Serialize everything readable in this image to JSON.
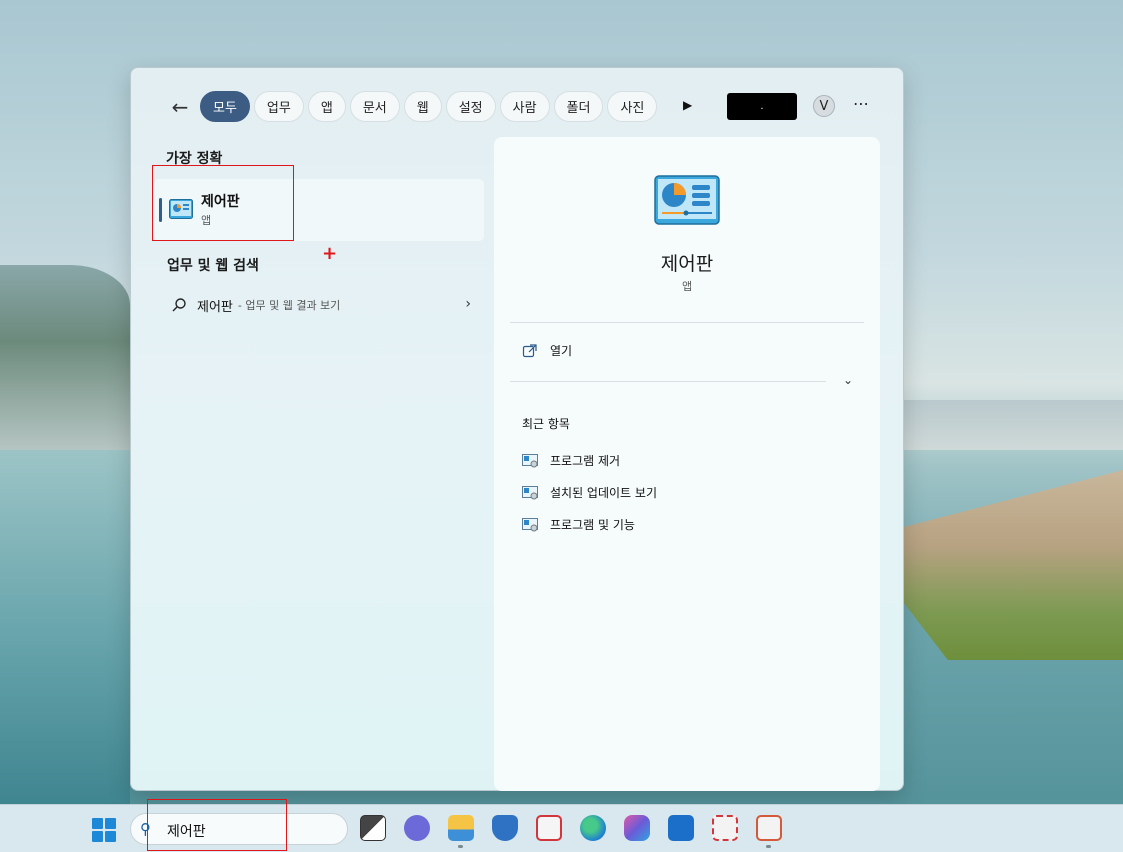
{
  "topbar": {
    "back_icon": "back-arrow-icon",
    "filters": [
      "모두",
      "업무",
      "앱",
      "문서",
      "웹",
      "설정",
      "사람",
      "폴더",
      "사진"
    ],
    "active_filter": "모두",
    "play_icon": "play-icon",
    "redacted_label": ".",
    "avatar_initial": "V",
    "more_label": "⋯"
  },
  "best_match": {
    "heading": "가장 정확",
    "name": "제어판",
    "type": "앱",
    "icon": "control-panel-icon"
  },
  "web_search": {
    "heading": "업무 및 웹 검색",
    "query": "제어판",
    "hint": "- 업무 및 웹 결과 보기",
    "icon": "search-icon",
    "chevron": "›"
  },
  "detail": {
    "name": "제어판",
    "type": "앱",
    "open_label": "열기",
    "expand_chevron": "⌄",
    "recent_heading": "최근 항목",
    "recent_items": [
      "프로그램 제거",
      "설치된 업데이트 보기",
      "프로그램 및 기능"
    ]
  },
  "taskbar": {
    "search_value": "제어판",
    "apps": [
      "task-view-icon",
      "teams-chat-icon",
      "file-explorer-icon",
      "security-icon",
      "sync-app-icon",
      "edge-icon",
      "copilot-icon",
      "mail-icon",
      "snipping-tool-icon",
      "powerpoint-icon"
    ]
  },
  "colors": {
    "accent": "#3c5c84",
    "highlight_box": "#e0161b",
    "windows_blue": "#1e88d8"
  }
}
